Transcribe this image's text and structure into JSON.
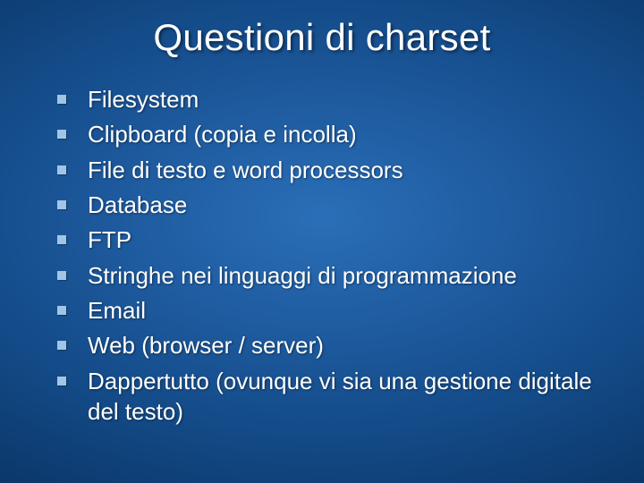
{
  "title": "Questioni di charset",
  "bullets": [
    "Filesystem",
    "Clipboard (copia e incolla)",
    "File di testo e word processors",
    "Database",
    "FTP",
    "Stringhe nei linguaggi di programmazione",
    "Email",
    "Web (browser / server)",
    "Dappertutto (ovunque vi sia una gestione digitale del testo)"
  ]
}
